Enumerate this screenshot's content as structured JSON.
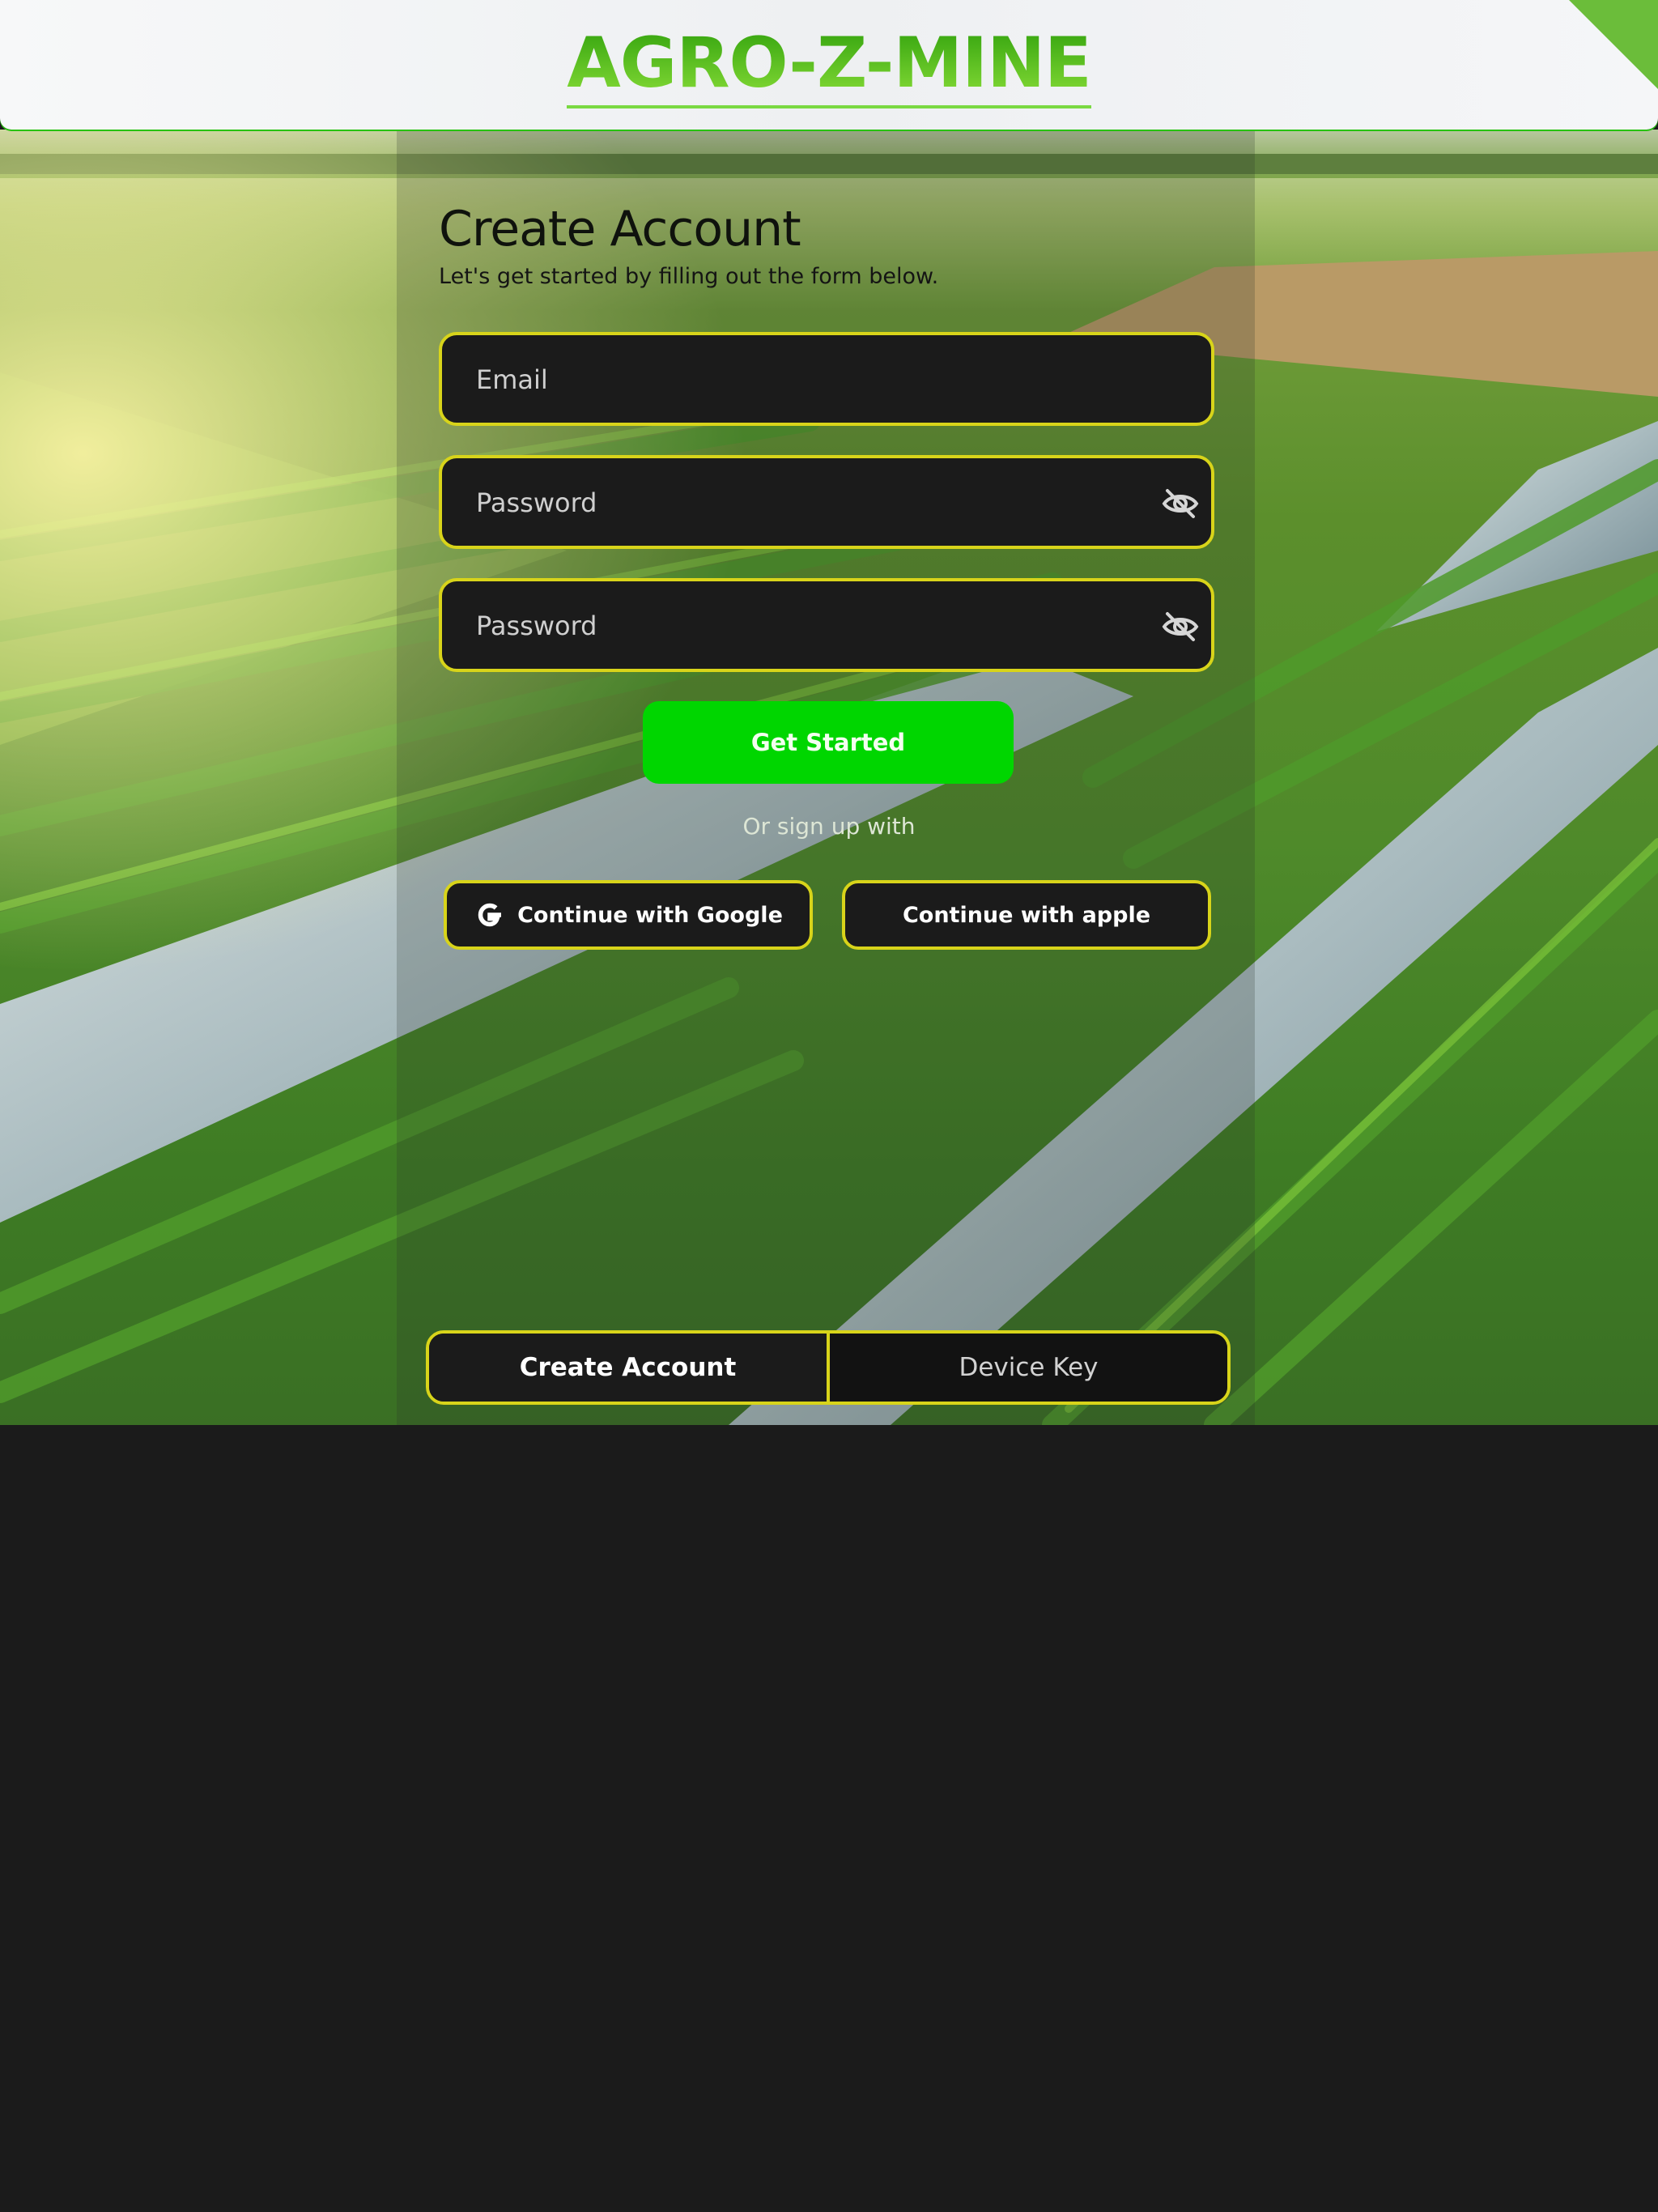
{
  "header": {
    "brand": "AGRO-Z-MINE"
  },
  "form": {
    "title": "Create Account",
    "subtitle": "Let's get started by filling out the form below.",
    "email": {
      "placeholder": "Email",
      "value": ""
    },
    "password": {
      "placeholder": "Password",
      "value": ""
    },
    "confirm_password": {
      "placeholder": "Password",
      "value": ""
    },
    "submit_label": "Get Started",
    "or_text": "Or sign up with",
    "google_label": "Continue with Google",
    "apple_label": "Continue with apple"
  },
  "tabs": {
    "create_account": "Create Account",
    "device_key": "Device Key"
  },
  "colors": {
    "accent": "#d8d41a",
    "primary": "#00d600",
    "field_bg": "#1b1b1b",
    "brand": "#4fb81a"
  },
  "icons": {
    "password_toggle": "eye-off-icon",
    "google": "google-icon"
  }
}
